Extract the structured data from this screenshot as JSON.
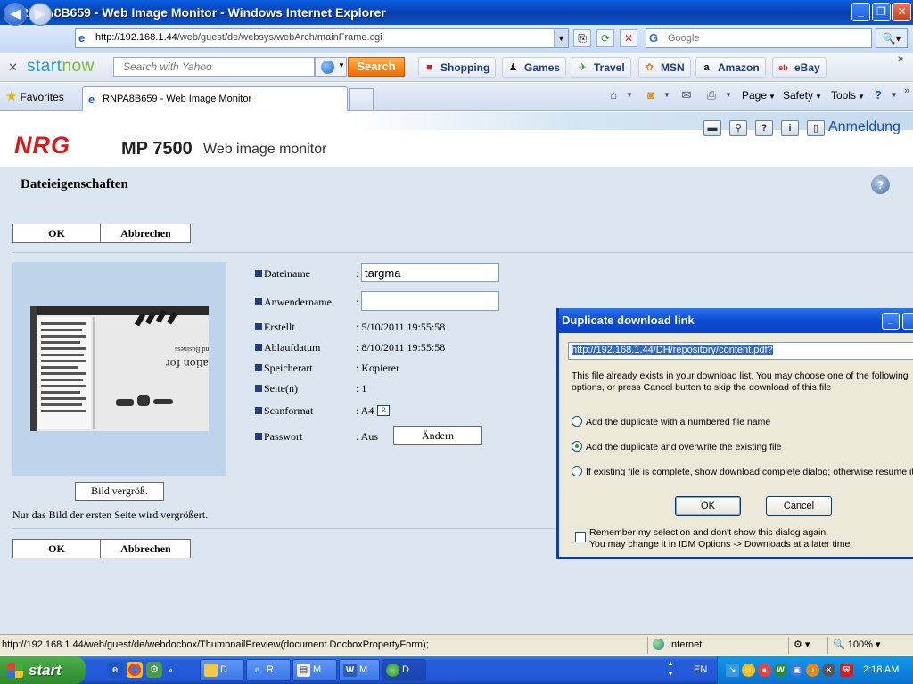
{
  "window": {
    "title": "RNPA8B659 - Web Image Monitor - Windows Internet Explorer"
  },
  "addressbar": {
    "url_prefix": "http://192.168.1.44",
    "url_path": "/web/guest/de/websys/webArch/mainFrame.cgi",
    "search_placeholder": "Google"
  },
  "startnow": {
    "logo_start": "start",
    "logo_now": "now",
    "search_placeholder": "Search with Yahoo",
    "search_button": "Search",
    "links": [
      {
        "label": "Shopping",
        "icon": "shopping-bag-icon"
      },
      {
        "label": "Games",
        "icon": "pawn-icon"
      },
      {
        "label": "Travel",
        "icon": "airplane-icon"
      },
      {
        "label": "MSN",
        "icon": "butterfly-icon"
      },
      {
        "label": "Amazon",
        "icon": "amazon-icon"
      },
      {
        "label": "eBay",
        "icon": "ebay-icon"
      }
    ]
  },
  "tabs": {
    "favorites": "Favorites",
    "active_tab": "RNPA8B659 - Web Image Monitor"
  },
  "commandbar": {
    "page": "Page",
    "safety": "Safety",
    "tools": "Tools"
  },
  "header": {
    "logo": "NRG",
    "model": "MP 7500",
    "subtitle": "Web image monitor",
    "login": "Anmeldung"
  },
  "page": {
    "title": "Dateieigenschaften",
    "ok": "OK",
    "cancel": "Abbrechen",
    "enlarge": "Bild vergröß.",
    "note": "Nur das Bild der ersten Seite wird vergrößert.",
    "change": "Ändern"
  },
  "properties": [
    {
      "label": "Dateiname",
      "value": "targma",
      "type": "input"
    },
    {
      "label": "Anwendername",
      "value": "",
      "type": "input"
    },
    {
      "label": "Erstellt",
      "value": ": 5/10/2011 19:55:58",
      "type": "text"
    },
    {
      "label": "Ablaufdatum",
      "value": ": 8/10/2011 19:55:58",
      "type": "text"
    },
    {
      "label": "Speicherart",
      "value": ": Kopierer",
      "type": "text"
    },
    {
      "label": "Seite(n)",
      "value": ": 1",
      "type": "text"
    },
    {
      "label": "Scanformat",
      "value": ": A4",
      "type": "text"
    },
    {
      "label": "Passwort",
      "value": ": Aus",
      "type": "text"
    }
  ],
  "thumbnail": {
    "text_lines": [
      "Translation for",
      "Statistics and Business"
    ]
  },
  "dialog": {
    "title": "Duplicate download link",
    "url": "http://192.168.1.44/DH/repository/content.pdf?",
    "message": "This file already exists in your download list. You may choose one of the following options, or press Cancel button to skip the download of this file",
    "options": [
      {
        "label": "Add the duplicate with a numbered file name",
        "selected": false
      },
      {
        "label": "Add the duplicate and overwrite the existing file",
        "selected": true
      },
      {
        "label": "If existing file is complete, show download complete dialog; otherwise resume it",
        "selected": false
      }
    ],
    "ok": "OK",
    "cancel": "Cancel",
    "remember_line1": "Remember my selection and don't show this dialog again.",
    "remember_line2": "You may change it in IDM Options -> Downloads at a later time."
  },
  "statusbar": {
    "text": "http://192.168.1.44/web/guest/de/webdocbox/ThumbnailPreview(document.DocboxPropertyForm);",
    "zone": "Internet",
    "zoom": "100%"
  },
  "taskbar": {
    "start": "start",
    "tasks": [
      {
        "label": "D",
        "icon": "folder-icon"
      },
      {
        "label": "R",
        "icon": "ie-icon"
      },
      {
        "label": "M",
        "icon": "document-icon"
      },
      {
        "label": "M",
        "icon": "word-icon"
      },
      {
        "label": "D",
        "icon": "idm-icon"
      }
    ],
    "lang": "EN",
    "clock": "2:18 AM"
  },
  "colors": {
    "brand_red": "#d8191d",
    "xp_blue": "#0a4bd0",
    "content_bg": "#dbe6f1"
  }
}
